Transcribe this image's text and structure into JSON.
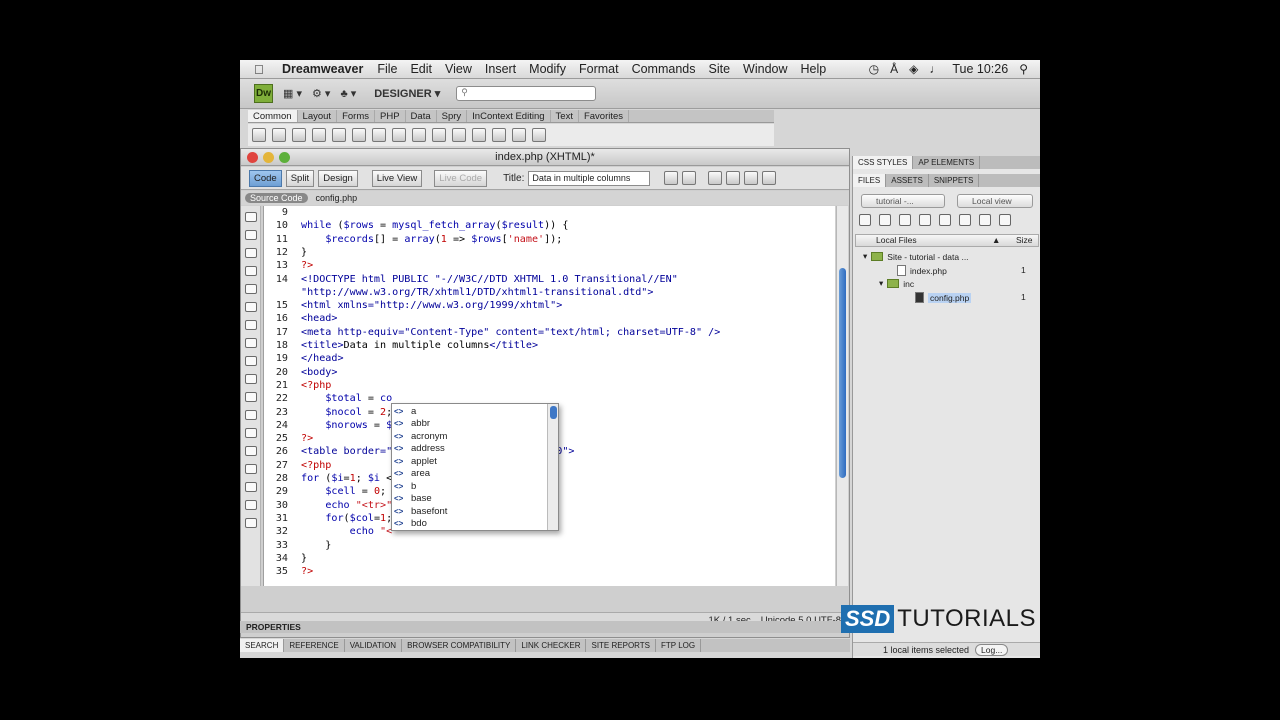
{
  "menubar": {
    "app_name": "Dreamweaver",
    "items": [
      "File",
      "Edit",
      "View",
      "Insert",
      "Modify",
      "Format",
      "Commands",
      "Site",
      "Window",
      "Help"
    ],
    "clock": "Tue 10:26"
  },
  "appbar": {
    "logo": "Dw",
    "workspace": "DESIGNER"
  },
  "insert_tabs": [
    "Common",
    "Layout",
    "Forms",
    "PHP",
    "Data",
    "Spry",
    "InContext Editing",
    "Text",
    "Favorites"
  ],
  "document": {
    "window_title": "index.php (XHTML)*",
    "view_buttons": [
      "Code",
      "Split",
      "Design"
    ],
    "live_view": "Live View",
    "live_code": "Live Code",
    "title_label": "Title:",
    "title_value": "Data in multiple columns",
    "related_files": [
      "Source Code",
      "config.php"
    ],
    "status_size": "1K / 1 sec",
    "status_encoding": "Unicode 5.0 UTF-8"
  },
  "code_lines": [
    {
      "n": "9",
      "html": ""
    },
    {
      "n": "10",
      "html": "<span class='kw'>while</span> (<span class='kw'>$rows</span> = <span class='kw'>mysql_fetch_array</span>(<span class='kw'>$result</span>)) {"
    },
    {
      "n": "11",
      "html": "    <span class='kw'>$records</span>[] = <span class='kw'>array</span>(<span class='red'>1</span> => <span class='kw'>$rows</span>[<span class='str'>'name'</span>]);"
    },
    {
      "n": "12",
      "html": "}"
    },
    {
      "n": "13",
      "html": "<span class='red'>?></span>"
    },
    {
      "n": "14",
      "html": "<span class='tag'>&lt;!DOCTYPE html PUBLIC \"-//W3C//DTD XHTML 1.0 Transitional//EN\"</span>"
    },
    {
      "n": "",
      "html": "<span class='tag'>\"http://www.w3.org/TR/xhtml1/DTD/xhtml1-transitional.dtd\"&gt;</span>"
    },
    {
      "n": "15",
      "html": "<span class='tag'>&lt;html xmlns=\"http://www.w3.org/1999/xhtml\"&gt;</span>"
    },
    {
      "n": "16",
      "html": "<span class='tag'>&lt;head&gt;</span>"
    },
    {
      "n": "17",
      "html": "<span class='tag'>&lt;meta http-equiv=\"Content-Type\" content=\"text/html; charset=UTF-8\" /&gt;</span>"
    },
    {
      "n": "18",
      "html": "<span class='tag'>&lt;title&gt;</span>Data in multiple columns<span class='tag'>&lt;/title&gt;</span>"
    },
    {
      "n": "19",
      "html": "<span class='tag'>&lt;/head&gt;</span>"
    },
    {
      "n": "20",
      "html": "<span class='tag'>&lt;body&gt;</span>"
    },
    {
      "n": "21",
      "html": "<span class='red'>&lt;?php</span>"
    },
    {
      "n": "22",
      "html": "    <span class='kw'>$total</span> = <span class='kw'>co</span>"
    },
    {
      "n": "23",
      "html": "    <span class='kw'>$nocol</span> = <span class='red'>2</span>;"
    },
    {
      "n": "24",
      "html": "    <span class='kw'>$norows</span> = <span class='kw'>$</span>"
    },
    {
      "n": "25",
      "html": "<span class='red'>?></span>"
    },
    {
      "n": "26",
      "html": "<span class='tag'>&lt;table border=\"</span>                      <span class='tag'>ing=\"0\"&gt;</span>"
    },
    {
      "n": "27",
      "html": "<span class='red'>&lt;?php</span>"
    },
    {
      "n": "28",
      "html": "<span class='kw'>for</span> (<span class='kw'>$i</span>=<span class='red'>1</span>; <span class='kw'>$i</span> &lt;"
    },
    {
      "n": "29",
      "html": "    <span class='kw'>$cell</span> = <span class='red'>0</span>;"
    },
    {
      "n": "30",
      "html": "    <span class='kw'>echo</span> <span class='str'>\"&lt;tr&gt;\"</span>"
    },
    {
      "n": "31",
      "html": "    <span class='kw'>for</span>(<span class='kw'>$col</span>=<span class='red'>1</span>;"
    },
    {
      "n": "32",
      "html": "        <span class='kw'>echo</span> <span class='str'>\"&lt;</span>"
    },
    {
      "n": "33",
      "html": "    }"
    },
    {
      "n": "34",
      "html": "}"
    },
    {
      "n": "35",
      "html": "<span class='red'>?></span>"
    }
  ],
  "autocomplete": [
    "a",
    "abbr",
    "acronym",
    "address",
    "applet",
    "area",
    "b",
    "base",
    "basefont",
    "bdo"
  ],
  "panels": {
    "bottom_label": "PROPERTIES",
    "bottom_tabs": [
      "SEARCH",
      "REFERENCE",
      "VALIDATION",
      "BROWSER COMPATIBILITY",
      "LINK CHECKER",
      "SITE REPORTS",
      "FTP LOG"
    ],
    "right_top_tabs": [
      "CSS STYLES",
      "AP ELEMENTS"
    ],
    "right_tabs": [
      "FILES",
      "ASSETS",
      "SNIPPETS"
    ],
    "site_select": "tutorial -...",
    "view_select": "Local view",
    "col_local": "Local Files",
    "col_size": "Size",
    "tree": {
      "site": "Site - tutorial - data ...",
      "index": "index.php",
      "index_size": "1",
      "inc": "inc",
      "config": "config.php",
      "config_size": "1"
    },
    "status": "1 local items selected",
    "log": "Log..."
  },
  "watermark": {
    "ssd": "SSD",
    "tutorials": "TUTORIALS"
  }
}
